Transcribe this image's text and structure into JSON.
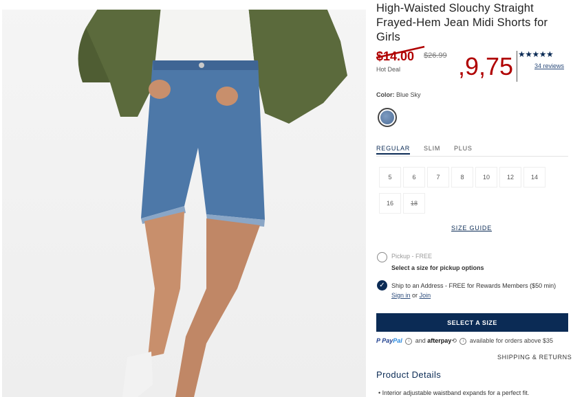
{
  "product": {
    "title": "High-Waisted Slouchy Straight Frayed-Hem Jean Midi Shorts for Girls",
    "old_sale_price": "$14.00",
    "original_price": "$26.99",
    "badge": "Hot Deal",
    "new_price": ",9,75",
    "rating_stars": "★★★★★",
    "reviews_link": "34 reviews"
  },
  "color": {
    "label": "Color:",
    "value": "Blue Sky"
  },
  "fit_tabs": [
    "REGULAR",
    "SLIM",
    "PLUS"
  ],
  "sizes": [
    {
      "label": "5",
      "available": true
    },
    {
      "label": "6",
      "available": true
    },
    {
      "label": "7",
      "available": true
    },
    {
      "label": "8",
      "available": true
    },
    {
      "label": "10",
      "available": true
    },
    {
      "label": "12",
      "available": true
    },
    {
      "label": "14",
      "available": true
    },
    {
      "label": "16",
      "available": true
    },
    {
      "label": "18",
      "available": false
    }
  ],
  "size_guide": "SIZE GUIDE",
  "fulfillment": {
    "pickup_label": "Pickup - FREE",
    "pickup_message": "Select a size for pickup options",
    "ship_text": "Ship to an Address - FREE for Rewards Members ($50 min)",
    "sign_in": "Sign in",
    "or": "or",
    "join": "Join"
  },
  "cta": "SELECT A SIZE",
  "payments": {
    "paypal_1": "Pay",
    "paypal_2": "Pal",
    "and": "and",
    "afterpay": "afterpay",
    "suffix": "available for orders above $35"
  },
  "shipping_returns": "SHIPPING & RETURNS",
  "details_title": "Product Details",
  "details_bullet": "Interior adjustable waistband expands for a perfect fit.",
  "colors": {
    "navy": "#0b2b55",
    "sale_red": "#b00000",
    "denim": "#4f6e97",
    "jacket": "#5b6a3c"
  }
}
